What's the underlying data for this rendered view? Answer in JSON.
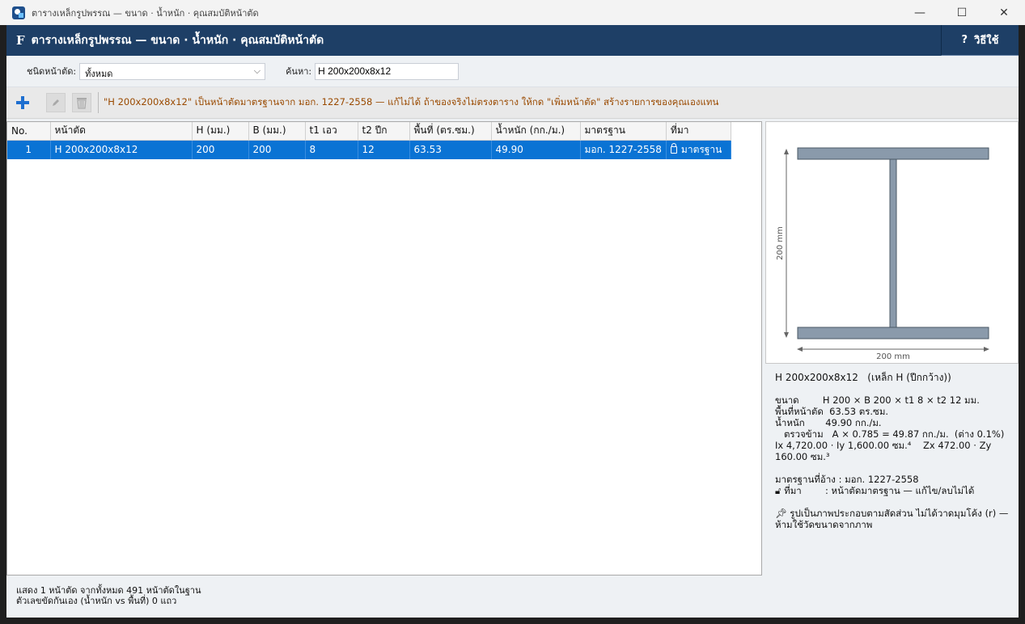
{
  "window": {
    "title": "ตารางเหล็กรูปพรรณ — ขนาด · น้ำหนัก · คุณสมบัติหน้าตัด",
    "minimize": "—",
    "maximize": "☐",
    "close": "✕"
  },
  "header": {
    "logo": "F",
    "title": "ตารางเหล็กรูปพรรณ — ขนาด · น้ำหนัก · คุณสมบัติหน้าตัด",
    "help_icon": "?",
    "help_label": "วิธีใช้"
  },
  "filters": {
    "section_type_label": "ชนิดหน้าตัด:",
    "section_type_value": "ทั้งหมด",
    "search_label": "ค้นหา:",
    "search_value": "H 200x200x8x12"
  },
  "toolbar": {
    "add_icon": "plus-icon",
    "edit_icon": "pencil-icon",
    "delete_icon": "trash-icon",
    "note": "\"H 200x200x8x12\" เป็นหน้าตัดมาตรฐานจาก มอก. 1227-2558 — แก้ไม่ได้ ถ้าของจริงไม่ตรงตาราง ให้กด \"เพิ่มหน้าตัด\" สร้างรายการของคุณเองแทน"
  },
  "table": {
    "columns": [
      "No.",
      "หน้าตัด",
      "H (มม.)",
      "B (มม.)",
      "t1 เอว",
      "t2 ปีก",
      "พื้นที่ (ตร.ซม.)",
      "น้ำหนัก (กก./ม.)",
      "มาตรฐาน",
      "ที่มา"
    ],
    "rows": [
      [
        "1",
        "H 200x200x8x12",
        "200",
        "200",
        "8",
        "12",
        "63.53",
        "49.90",
        "มอก. 1227-2558",
        "มาตรฐาน"
      ]
    ]
  },
  "drawing": {
    "height_label": "200 mm",
    "width_label": "200 mm",
    "fill_color": "#8a9aab",
    "stroke_color": "#4a5866"
  },
  "details": {
    "name": "H 200x200x8x12   (เหล็ก H (ปีกกว้าง))",
    "size_line": "ขนาด        H 200 × B 200 × t1 8 × t2 12 มม.",
    "area_line": "พื้นที่หน้าตัด  63.53 ตร.ซม.",
    "weight_line": "น้ำหนัก       49.90 กก./ม.",
    "check_line": "   ตรวจข้าม   A × 0.785 = 49.87 กก./ม.  (ต่าง 0.1%)",
    "inertia_line": "Ix 4,720.00 · Iy 1,600.00 ซม.⁴    Zx 472.00 · Zy",
    "inertia_line2": "160.00 ซม.³",
    "standard_line": "มาตรฐานที่อ้าง : มอก. 1227-2558",
    "source_line": "ที่มา        : หน้าตัดมาตรฐาน — แก้ไข/ลบไม่ได้",
    "note_line1": "รูปเป็นภาพประกอบตามสัดส่วน ไม่ได้วาดมุมโค้ง (r) —",
    "note_line2": "ห้ามใช้วัดขนาดจากภาพ"
  },
  "status": {
    "line1": "แสดง 1 หน้าตัด จากทั้งหมด 491 หน้าตัดในฐาน",
    "line2": "ตัวเลขขัดกันเอง (น้ำหนัก vs พื้นที่) 0 แถว"
  },
  "colors": {
    "header_bg": "#1e3f66",
    "selection": "#0a73d4",
    "note_text": "#9a4a00"
  }
}
